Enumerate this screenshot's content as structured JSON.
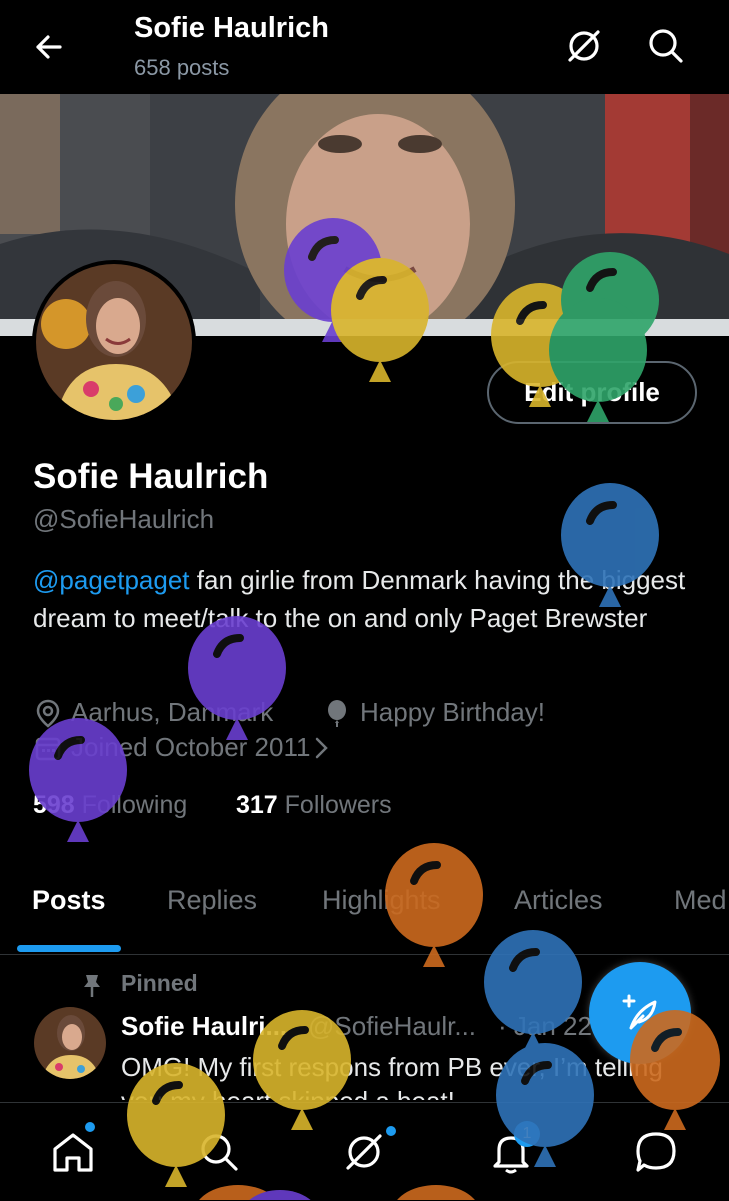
{
  "header": {
    "name": "Sofie Haulrich",
    "post_count": "658 posts"
  },
  "profile": {
    "edit_label": "Edit profile",
    "display_name": "Sofie Haulrich",
    "handle": "@SofieHaulrich",
    "bio_mention": "@pagetpaget",
    "bio_text": " fan girlie from Denmark having the biggest dream to meet/talk to the on and only Paget Brewster",
    "location": "Aarhus, Danmark",
    "birthday": "Happy Birthday!",
    "joined": "Joined October 2011",
    "following_count": "598",
    "following_label": " Following",
    "followers_count": "317",
    "followers_label": " Followers"
  },
  "tabs": [
    {
      "label": "Posts"
    },
    {
      "label": "Replies"
    },
    {
      "label": "Highlights"
    },
    {
      "label": "Articles"
    },
    {
      "label": "Med"
    }
  ],
  "pinned_post": {
    "pinned_label": "Pinned",
    "author": "Sofie Haulri...",
    "handle": "@SofieHaulr...",
    "date": "· Jan 22",
    "text": "OMG! My first respons from PB ever, I’m telling you my heart skipped a beat!"
  },
  "bottom_nav": {
    "notification_badge": "1",
    "items": [
      {
        "icon": "home-icon"
      },
      {
        "icon": "search-icon"
      },
      {
        "icon": "grok-icon"
      },
      {
        "icon": "bell-icon"
      },
      {
        "icon": "messages-icon"
      }
    ]
  },
  "colors": {
    "accent": "#1d9bf0",
    "background": "#000000",
    "muted": "#71767b",
    "balloon_purple": "#6a3fd0",
    "balloon_yellow": "#d9b52c",
    "balloon_green": "#2fa56a",
    "balloon_blue": "#2f73b8",
    "balloon_orange": "#cc6a1e"
  }
}
